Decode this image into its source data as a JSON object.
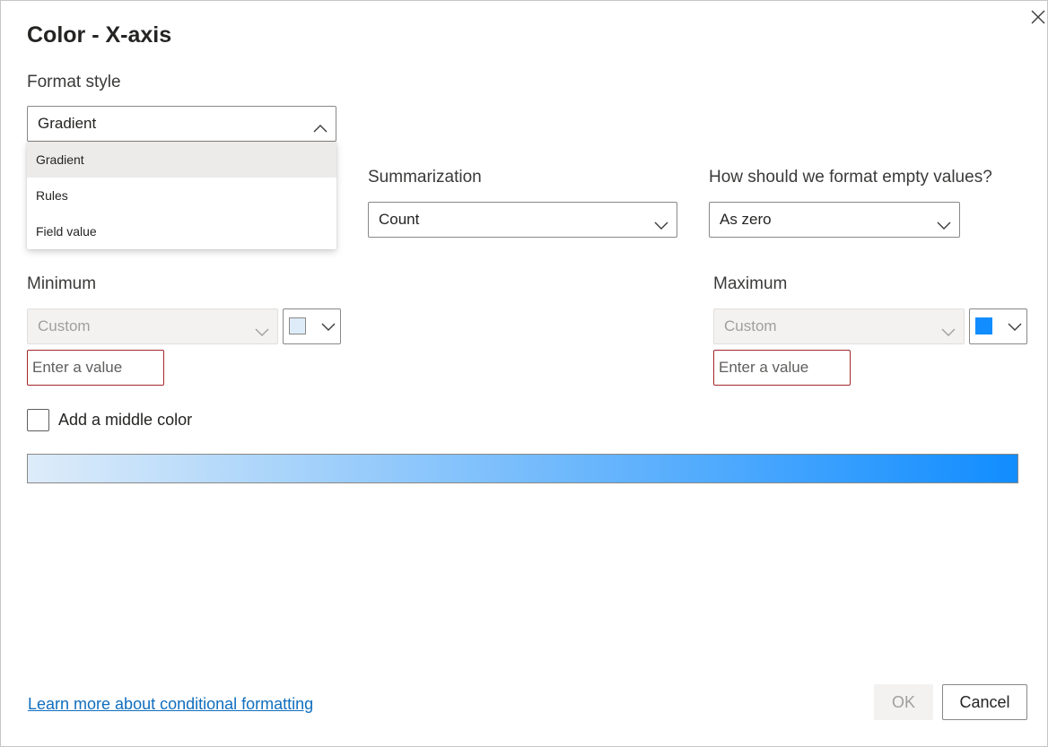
{
  "dialog": {
    "title": "Color - X-axis"
  },
  "format_style": {
    "label": "Format style",
    "selected": "Gradient",
    "options": [
      "Gradient",
      "Rules",
      "Field value"
    ]
  },
  "summarization": {
    "label": "Summarization",
    "selected": "Count"
  },
  "empty_values": {
    "label": "How should we format empty values?",
    "selected": "As zero"
  },
  "minimum": {
    "label": "Minimum",
    "type": "Custom",
    "value_placeholder": "Enter a value",
    "color": "#deecf9"
  },
  "maximum": {
    "label": "Maximum",
    "type": "Custom",
    "value_placeholder": "Enter a value",
    "color": "#118dff"
  },
  "middle_color": {
    "label": "Add a middle color",
    "checked": false
  },
  "footer": {
    "learn_more": "Learn more about conditional formatting",
    "ok_label": "OK",
    "cancel_label": "Cancel"
  },
  "icons": {
    "close": "close-icon",
    "chevron_down": "chevron-down-icon",
    "chevron_up": "chevron-up-icon"
  }
}
